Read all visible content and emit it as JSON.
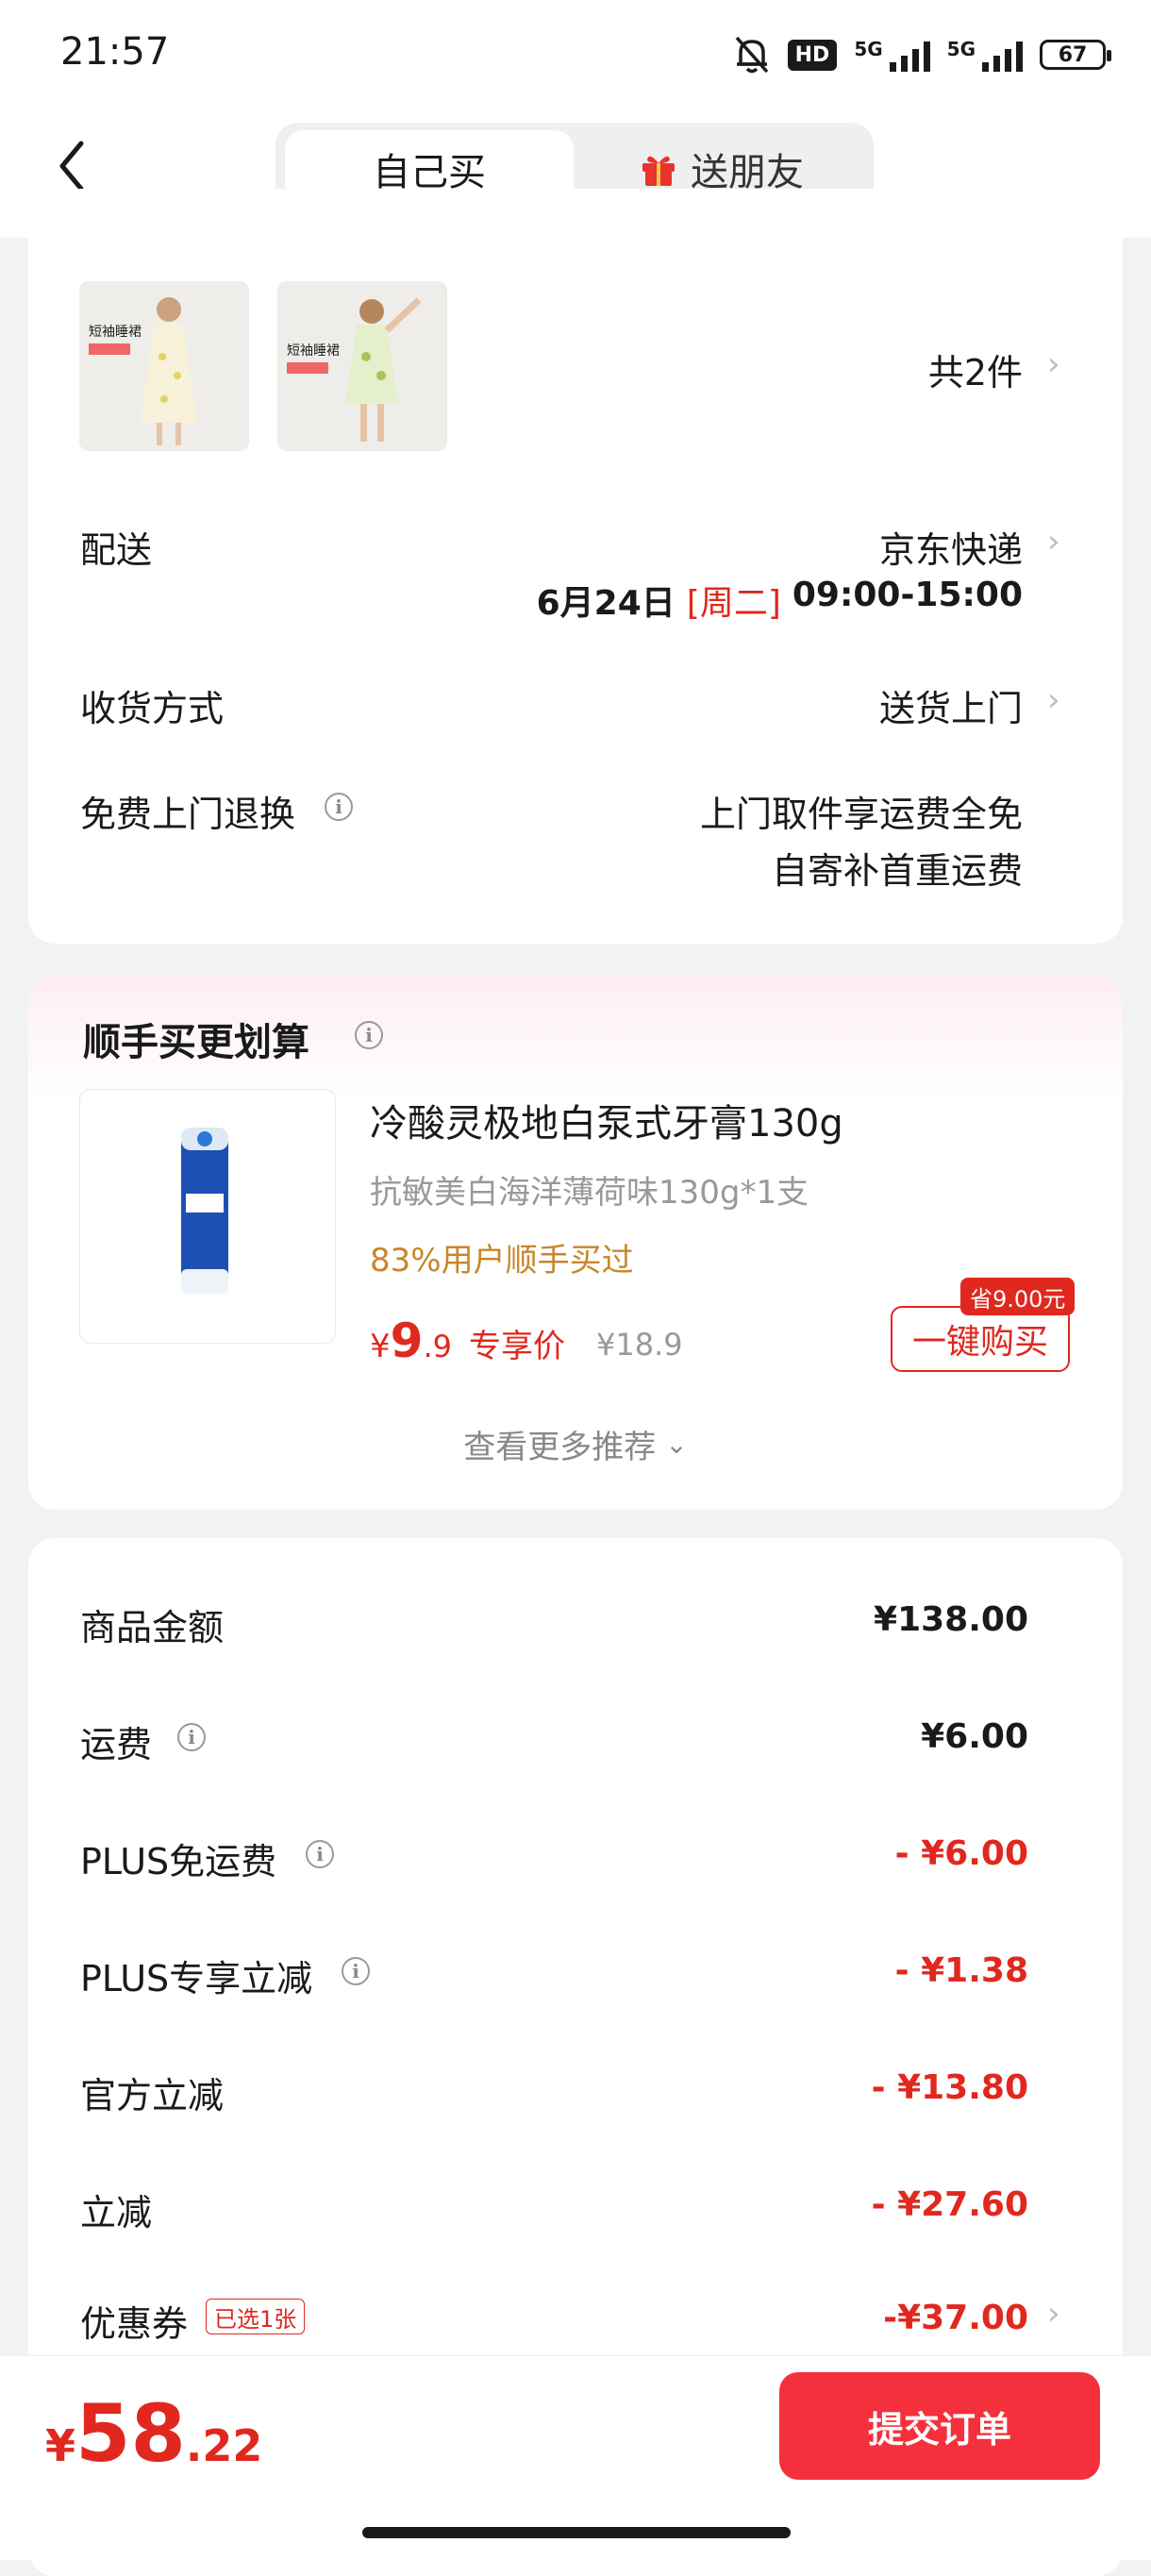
{
  "status": {
    "time": "21:57",
    "hd": "HD",
    "net1": "5G",
    "net2": "5G",
    "battery": "67"
  },
  "header": {
    "tab_self": "自己买",
    "tab_gift": "送朋友"
  },
  "items": {
    "count_text": "共2件",
    "thumb1_tag": "短袖睡裙",
    "thumb2_tag": "短袖睡裙"
  },
  "delivery": {
    "label": "配送",
    "carrier": "京东快递",
    "date": "6月24日",
    "weekday": "[周二]",
    "time": "09:00-15:00"
  },
  "receive": {
    "label": "收货方式",
    "value": "送货上门"
  },
  "returns": {
    "label": "免费上门退换",
    "line1": "上门取件享运费全免",
    "line2": "自寄补首重运费"
  },
  "addon": {
    "title": "顺手买更划算",
    "product_name": "冷酸灵极地白泵式牙膏130g",
    "spec": "抗敏美白海洋薄荷味130g*1支",
    "stat": "83%用户顺手买过",
    "currency": "¥",
    "price_int": "9",
    "price_dec": ".9",
    "price_tag": "专享价",
    "orig_price": "¥18.9",
    "save_badge": "省9.00元",
    "buy_button": "一键购买",
    "more": "查看更多推荐"
  },
  "summary": {
    "goods_label": "商品金额",
    "goods_val": "¥138.00",
    "ship_label": "运费",
    "ship_val": "¥6.00",
    "plus_free_label": "PLUS免运费",
    "plus_free_val": "- ¥6.00",
    "plus_cut_label": "PLUS专享立减",
    "plus_cut_val": "- ¥1.38",
    "official_label": "官方立减",
    "official_val": "- ¥13.80",
    "cut_label": "立减",
    "cut_val": "- ¥27.60",
    "coupon_label": "优惠券",
    "coupon_badge": "已选1张",
    "coupon_val": "-¥37.00"
  },
  "bottom": {
    "currency": "¥",
    "total_int": "58",
    "total_dec": ".22",
    "submit": "提交订单"
  },
  "colors": {
    "accent_red": "#e0281f",
    "button_red": "#f5303d",
    "orange": "#c8862a"
  }
}
